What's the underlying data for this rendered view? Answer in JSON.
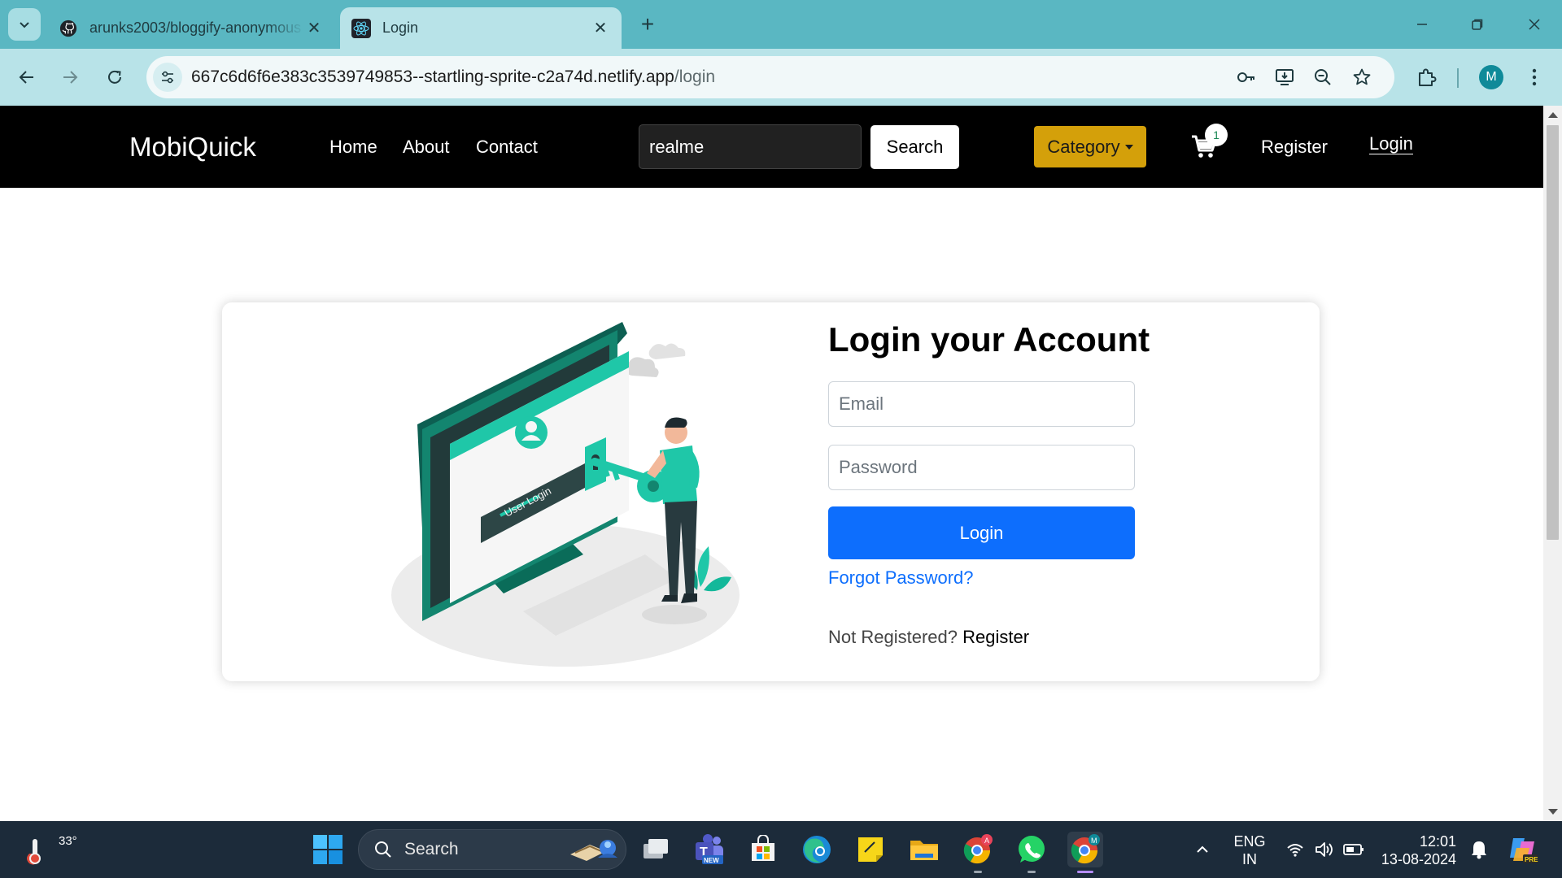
{
  "browser": {
    "tabs": [
      {
        "title": "arunks2003/bloggify-anonymous",
        "icon": "github-icon",
        "active": false
      },
      {
        "title": "Login",
        "icon": "react-icon",
        "active": true
      }
    ],
    "url_host": "667c6d6f6e383c3539749853--startling-sprite-c2a74d.netlify.app",
    "url_path": "/login",
    "profile_initial": "M"
  },
  "site": {
    "brand": "MobiQuick",
    "nav": {
      "home": "Home",
      "about": "About",
      "contact": "Contact"
    },
    "search": {
      "value": "realme",
      "button": "Search"
    },
    "category_label": "Category",
    "cart_count": "1",
    "register_link": "Register",
    "login_link": "Login"
  },
  "login": {
    "title": "Login your Account",
    "email_placeholder": "Email",
    "password_placeholder": "Password",
    "submit_label": "Login",
    "forgot_label": "Forgot Password?",
    "not_registered": "Not Registered?",
    "register_label": "Register",
    "illustration_caption": "User Login"
  },
  "taskbar": {
    "temperature": "33°",
    "search_label": "Search",
    "language": "ENG",
    "region": "IN",
    "time": "12:01",
    "date": "13-08-2024",
    "teams_badge": "NEW",
    "copilot_badge": "PRE",
    "chrome_profile_a": "A",
    "chrome_profile_m": "M"
  },
  "colors": {
    "tabstrip": "#5ab7c2",
    "toolbar": "#b8e3e8",
    "site_nav": "#000000",
    "category": "#d4a00a",
    "primary": "#0d6efd",
    "illustration_teal": "#1fc7a8",
    "taskbar": "#1c2b3a"
  }
}
